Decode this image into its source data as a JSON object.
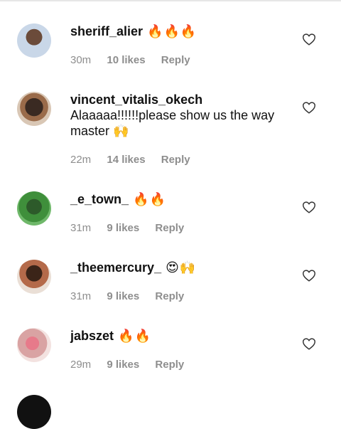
{
  "comments": [
    {
      "username": "sheriff_alier",
      "emoji": "🔥🔥🔥",
      "text": "",
      "time": "30m",
      "likes": "10 likes",
      "reply": "Reply"
    },
    {
      "username": "vincent_vitalis_okech",
      "emoji": "",
      "text": "Alaaaaa!!!!!!please show us the way master 🙌",
      "time": "22m",
      "likes": "14 likes",
      "reply": "Reply"
    },
    {
      "username": "_e_town_",
      "emoji": "🔥🔥",
      "text": "",
      "time": "31m",
      "likes": "9 likes",
      "reply": "Reply"
    },
    {
      "username": "_theemercury_",
      "emoji": "😍🙌",
      "text": "",
      "time": "31m",
      "likes": "9 likes",
      "reply": "Reply"
    },
    {
      "username": "jabszet",
      "emoji": "🔥🔥",
      "text": "",
      "time": "29m",
      "likes": "9 likes",
      "reply": "Reply"
    }
  ],
  "icons": {
    "like": "heart-outline-icon"
  }
}
